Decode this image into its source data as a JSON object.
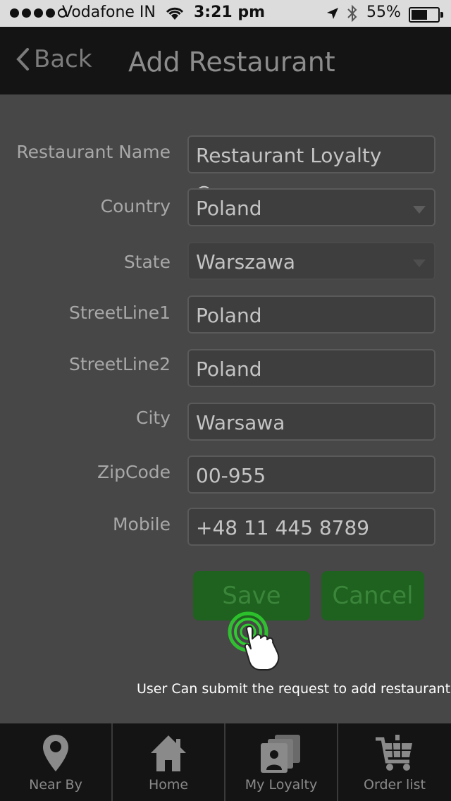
{
  "status": {
    "carrier": "Vodafone IN",
    "time": "3:21 pm",
    "battery": "55%",
    "signal_bars": 4
  },
  "nav": {
    "back_label": "Back",
    "title": "Add Restaurant"
  },
  "form": {
    "restaurant_name": {
      "label": "Restaurant Name",
      "value": "Restaurant Loyalty Camp"
    },
    "country": {
      "label": "Country",
      "value": "Poland"
    },
    "state": {
      "label": "State",
      "value": "Warszawa"
    },
    "street1": {
      "label": "StreetLine1",
      "value": "Poland"
    },
    "street2": {
      "label": "StreetLine2",
      "value": "Poland"
    },
    "city": {
      "label": "City",
      "value": "Warsawa"
    },
    "zip": {
      "label": "ZipCode",
      "value": "00-955"
    },
    "mobile": {
      "label": "Mobile",
      "value": "+48 11 445 8789"
    }
  },
  "buttons": {
    "save": "Save",
    "cancel": "Cancel"
  },
  "hint": "User Can submit the request to add restaurant",
  "tabs": [
    {
      "label": "Near By",
      "icon": "location-pin-icon"
    },
    {
      "label": "Home",
      "icon": "home-icon"
    },
    {
      "label": "My Loyalty",
      "icon": "loyalty-cards-icon"
    },
    {
      "label": "Order list",
      "icon": "cart-icon"
    }
  ],
  "colors": {
    "accent_green": "#1f611f",
    "tap_glow": "#2ecc2e"
  }
}
